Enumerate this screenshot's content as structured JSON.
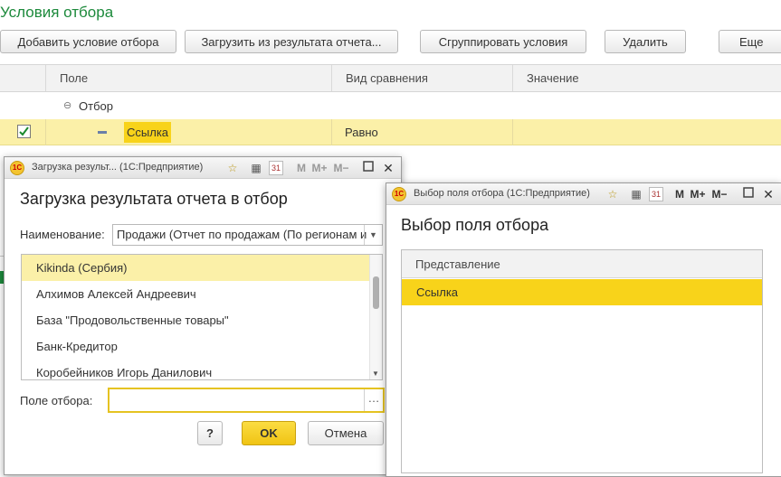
{
  "main": {
    "title": "Условия отбора",
    "toolbar": {
      "add": "Добавить условие отбора",
      "load": "Загрузить из результата отчета...",
      "group": "Сгруппировать условия",
      "delete": "Удалить",
      "more": "Еще"
    },
    "grid": {
      "col_field": "Поле",
      "col_comparison": "Вид сравнения",
      "col_value": "Значение",
      "group_row": "Отбор",
      "row_field": "Ссылка",
      "row_comparison": "Равно"
    }
  },
  "dialog_load": {
    "window_title": "Загрузка результ... (1С:Предприятие)",
    "heading": "Загрузка результата отчета в отбор",
    "name_label": "Наименование:",
    "name_value": "Продажи (Отчет по продажам (По регионам и",
    "items": [
      "Kikinda (Сербия)",
      "Алхимов Алексей Андреевич",
      "База \"Продовольственные товары\"",
      "Банк-Кредитор",
      "Коробейников Игорь Данилович"
    ],
    "filter_label": "Поле отбора:",
    "filter_value": "",
    "help": "?",
    "ok": "OK",
    "cancel": "Отмена"
  },
  "dialog_field": {
    "window_title": "Выбор поля отбора (1С:Предприятие)",
    "heading": "Выбор поля отбора",
    "col_header": "Представление",
    "items": [
      "Ссылка"
    ]
  },
  "toolbar_glyphs": {
    "m": "M",
    "m_plus": "M+",
    "m_minus": "M−",
    "calendar": "31"
  },
  "colors": {
    "title_green": "#1d8a3c",
    "selection_yellow": "#f8d31a",
    "row_highlight": "#fbf0a8",
    "ok_button": "#f5cf1e"
  }
}
